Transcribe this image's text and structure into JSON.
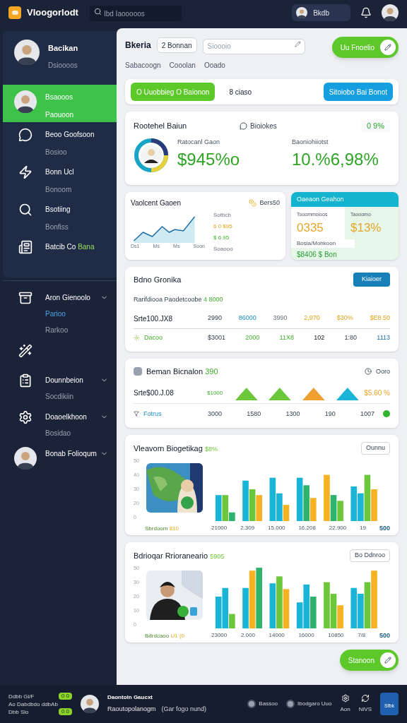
{
  "topbar": {
    "logo": "Vloogorlodt",
    "search": {
      "placeholder": "Ibd Iaooooos"
    },
    "user": "Bkdb"
  },
  "sidebar": {
    "profile": {
      "name": "Bacikan",
      "sub": "Dsioooos"
    },
    "items": [
      {
        "kind": "avatar",
        "title": "Bsaooos",
        "sub": "Paouoon",
        "selected": true
      },
      {
        "kind": "chat",
        "title": "Beoo Goofsoon",
        "sub": "Bosioo",
        "selected": false
      },
      {
        "kind": "bolt",
        "title": "Bonn Ucl",
        "sub": "Bonoom",
        "selected": false
      },
      {
        "kind": "search",
        "title": "Bsotiing",
        "sub": "Bonfiss",
        "selected": false
      },
      {
        "kind": "board",
        "title": "Batcib Co",
        "badge": "Bana",
        "selected": false
      }
    ],
    "groups": [
      {
        "kind": "box",
        "title": "Aron Gienoolo",
        "children": [
          {
            "label": "Parioo",
            "selected": true
          },
          {
            "label": "Rarkoo",
            "selected": false
          }
        ]
      },
      {
        "kind": "wand"
      },
      {
        "kind": "clipboard",
        "title": "Dounnbeion",
        "children": [
          {
            "label": "Socdikiin",
            "selected": false
          }
        ]
      },
      {
        "kind": "gear",
        "title": "Doaoelkhoon",
        "children": [
          {
            "label": "Bosidao",
            "selected": false
          }
        ]
      },
      {
        "kind": "avatar",
        "title": "Bonab Folioqum"
      }
    ]
  },
  "header": {
    "title": "Bkeria",
    "chip": "2 Bonnan",
    "field": {
      "placeholder": "Sioooio"
    },
    "action": "Uu Fnoelio",
    "links": [
      "Sabacoogn",
      "Cooolan",
      "Ooado"
    ]
  },
  "toolbar": {
    "tabs": [
      {
        "label": "O Uuobbieg O Baionon",
        "selected": true
      },
      {
        "label": "8 ciaso",
        "selected": false
      }
    ],
    "button": "Sitoiobo Bai Bonot"
  },
  "summary": {
    "title": "Rootehel Baiun",
    "filter": "Bioiokes",
    "change": "0 9%",
    "stats": [
      {
        "label": "Ratocanl Gaon",
        "value": "$945%o"
      },
      {
        "label": "Baoniohiiotst",
        "value": "10.%6,98%"
      }
    ]
  },
  "trend": {
    "title": "Vaolcent Gaoen",
    "badge": "Bers50",
    "legend": [
      "Sotbcb",
      "6 0 $95",
      "$ 6 95",
      "Soaooo"
    ],
    "x_labels": [
      "Ds1",
      "Ms",
      "Ms",
      "Soon"
    ]
  },
  "balance": {
    "title": "Oaeaon Geahon",
    "cells": [
      {
        "label": "Tooommoioos",
        "value": "0335"
      },
      {
        "label": "Taooomo",
        "value": "$13%"
      }
    ],
    "note": "Bosia/Mohkoon",
    "total": "$8406 $ Bon"
  },
  "table1": {
    "title": "Bdno Gronika",
    "button": "Kiaioer",
    "subtitle": "Rarifdiooa Paodetcoobe",
    "subtitle_value": "4 8000",
    "row_label": "Srte100.JX8",
    "values": [
      "2990",
      "86000",
      "3990",
      "2,970",
      "$30%",
      "$E8.50"
    ],
    "footer_label": "Dacoo",
    "footer": [
      "$3001",
      "2000",
      "11X8",
      "102",
      "1:80",
      "1113"
    ]
  },
  "table2": {
    "title": "Beman Bicnalon",
    "title_value": "390",
    "filter": "Ooro",
    "row_label": "Srte$00.J.08",
    "first": "$1000",
    "minis": [
      {
        "color": "#6cc73a"
      },
      {
        "color": "#6cc73a"
      },
      {
        "color": "#f0a030"
      },
      {
        "color": "#19b4d6"
      }
    ],
    "end": "$5.60 %",
    "footer_label": "Fotrus",
    "footer": [
      "3000",
      "1580",
      "1300",
      "190",
      "1007"
    ]
  },
  "charts": [
    {
      "title": "Vleavorn Biogetikag",
      "title_value": "$8%",
      "button": "Ounnu",
      "y_labels": [
        "50",
        "40",
        "30",
        "20",
        "0"
      ],
      "caption": "Sbrdoom",
      "caption_value": "810",
      "x_labels": [
        "21000",
        "2.309",
        "15.000",
        "16.208",
        "22.900",
        "19"
      ],
      "end": "500"
    },
    {
      "title": "Bdrioqar Rrioraneario",
      "title_value": "5905",
      "button": "Bo Ddnroo",
      "y_labels": [
        "50",
        "30",
        "20",
        "10",
        "0"
      ],
      "caption": "Bdrdcaoo",
      "caption_value": "U1 (0",
      "x_labels": [
        "23000",
        "2.000",
        "14000",
        "16000",
        "10850",
        "7/8"
      ],
      "end": "500"
    }
  ],
  "fab": "Stanoon",
  "bottom": {
    "status": [
      {
        "label": "Ddbb Gi/F",
        "badge": "0 0"
      },
      {
        "label": "Ao Dabdbdo ddbAb"
      },
      {
        "label": "Dbb Sio",
        "badge": "0 0"
      }
    ],
    "name": "Daontoln Gaucxt",
    "sub": "Raoutopolanogm",
    "sub2": "(Gar fogo nund)",
    "items": [
      "Bassoo",
      "Ibodgaro Uuo"
    ],
    "icons": [
      "Aon",
      "NiVS"
    ],
    "flag": "Sfbk"
  }
}
